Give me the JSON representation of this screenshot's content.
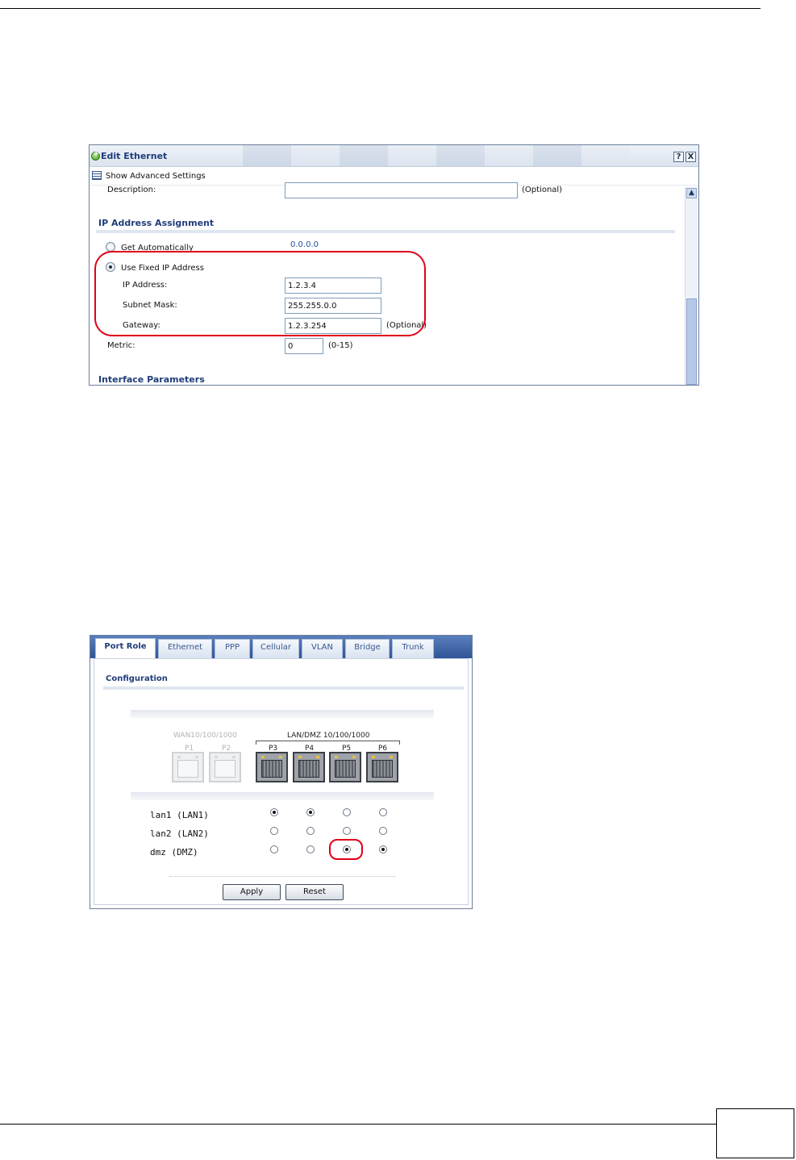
{
  "edit_ethernet": {
    "title": "Edit Ethernet",
    "help_button": "?",
    "close_button": "X",
    "advanced_toggle": "Show Advanced Settings",
    "description": {
      "label": "Description:",
      "value": "",
      "hint": "(Optional)"
    },
    "ip_section": "IP Address Assignment",
    "get_automatically": {
      "label": "Get Automatically",
      "value": "0.0.0.0",
      "selected": false
    },
    "use_fixed_ip": {
      "label": "Use Fixed IP Address",
      "selected": true
    },
    "ip_address": {
      "label": "IP Address:",
      "value": "1.2.3.4"
    },
    "subnet_mask": {
      "label": "Subnet Mask:",
      "value": "255.255.0.0"
    },
    "gateway": {
      "label": "Gateway:",
      "value": "1.2.3.254",
      "hint": "(Optional)"
    },
    "metric": {
      "label": "Metric:",
      "value": "0",
      "hint": "(0-15)"
    },
    "interface_section": "Interface Parameters",
    "scroll_up": "▲"
  },
  "port_role": {
    "tabs": [
      "Port Role",
      "Ethernet",
      "PPP",
      "Cellular",
      "VLAN",
      "Bridge",
      "Trunk"
    ],
    "active_tab": "Port Role",
    "section": "Configuration",
    "wan_group": "WAN10/100/1000",
    "lan_group": "LAN/DMZ  10/100/1000",
    "ports": [
      "P1",
      "P2",
      "P3",
      "P4",
      "P5",
      "P6"
    ],
    "rows": [
      {
        "label": "lan1 (LAN1)",
        "selected_port": [
          "P3",
          "P4"
        ]
      },
      {
        "label": "lan2 (LAN2)",
        "selected_port": []
      },
      {
        "label": "dmz (DMZ)",
        "selected_port": [
          "P5",
          "P6"
        ]
      }
    ],
    "apply": "Apply",
    "reset": "Reset"
  }
}
